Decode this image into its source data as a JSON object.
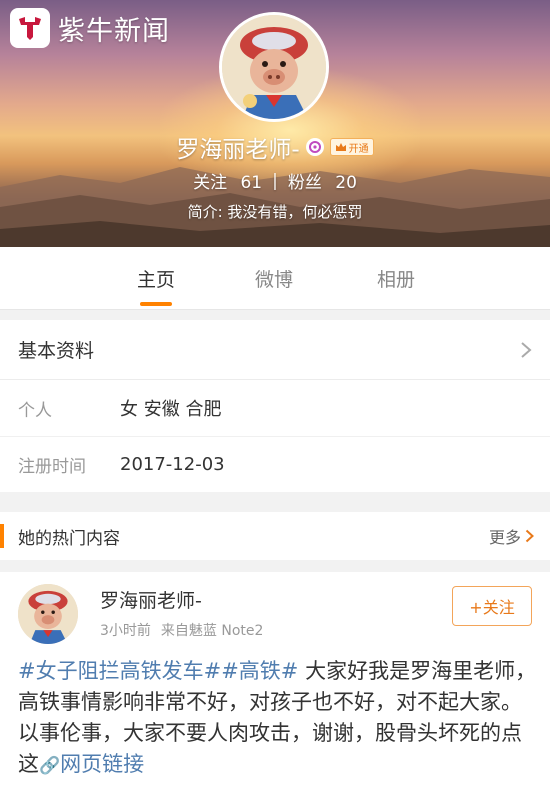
{
  "brand": {
    "name": "紫牛新闻",
    "logo_icon": "zi-niu-logo-icon",
    "logo_color": "#c8173d"
  },
  "profile": {
    "name": "罗海丽老师-",
    "vip_label": "开通",
    "following_label": "关注",
    "following_count": "61",
    "divider": "|",
    "followers_label": "粉丝",
    "followers_count": "20",
    "bio": "简介: 我没有错，何必惩罚"
  },
  "tabs": [
    {
      "label": "主页",
      "active": true
    },
    {
      "label": "微博",
      "active": false
    },
    {
      "label": "相册",
      "active": false
    }
  ],
  "info": {
    "title": "基本资料",
    "rows": [
      {
        "label": "个人",
        "value": "女  安徽 合肥"
      },
      {
        "label": "注册时间",
        "value": "2017-12-03"
      }
    ]
  },
  "hot": {
    "title": "她的热门内容",
    "more": "更多"
  },
  "post": {
    "author": "罗海丽老师-",
    "time": "3小时前",
    "source": "来自魅蓝 Note2",
    "follow_label": "+关注",
    "topic1": "#女子阻拦高铁发车#",
    "topic2": "#高铁#",
    "body": " 大家好我是罗海里老师，高铁事情影响非常不好，对孩子也不好，对不起大家。以事伦事，大家不要人肉攻击，谢谢，股骨头坏死的点这",
    "link_label": "网页链接"
  },
  "colors": {
    "accent": "#ff8200",
    "link": "#507daf"
  }
}
